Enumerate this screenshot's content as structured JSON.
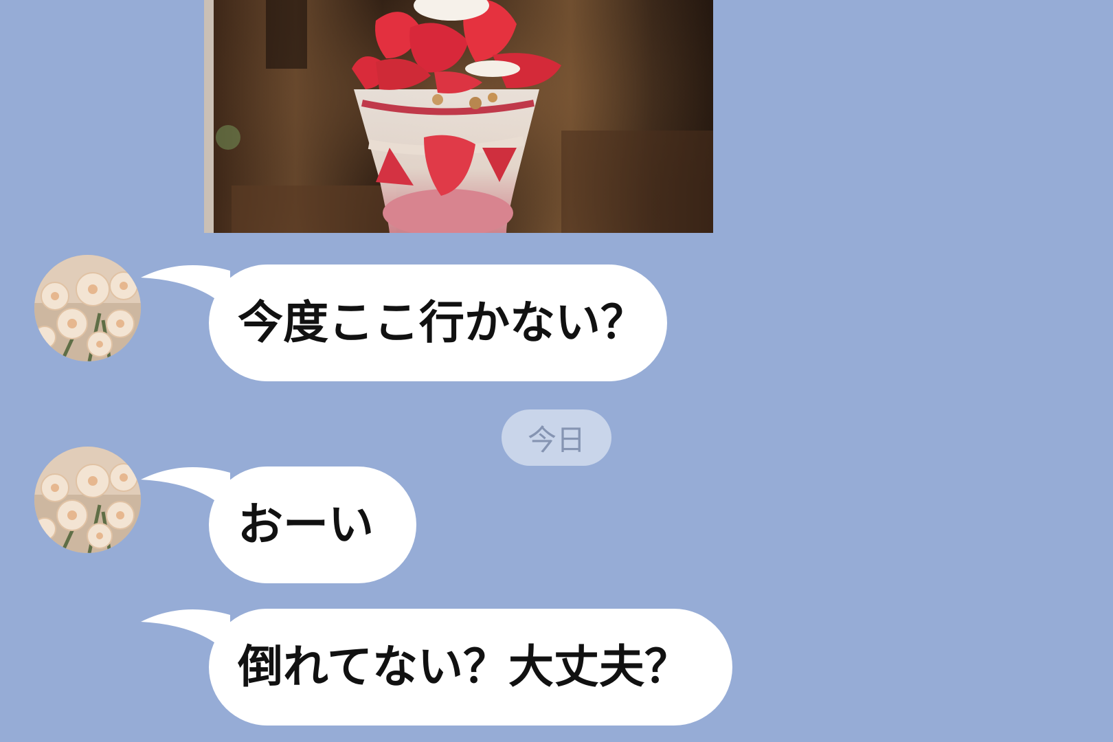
{
  "chat": {
    "photo": {
      "alt": "photo-strawberry-parfait"
    },
    "messages": [
      {
        "text": "今度ここ行かない？",
        "avatar": "flower-avatar"
      },
      {
        "text": "おーい",
        "avatar": "flower-avatar"
      },
      {
        "text": "倒れてない？大丈夫？",
        "avatar": ""
      }
    ],
    "date_separator": "今日"
  },
  "colors": {
    "background": "#96acd6",
    "bubble": "#ffffff",
    "date_pill": "#c9d5ea",
    "date_text": "#8594b2"
  }
}
